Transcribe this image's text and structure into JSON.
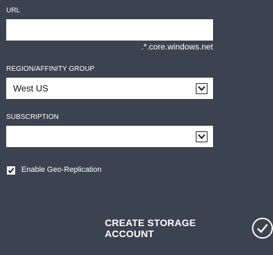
{
  "url": {
    "label": "URL",
    "value": "",
    "suffix": ".*.core.windows.net"
  },
  "region": {
    "label": "REGION/AFFINITY GROUP",
    "selected": "West US"
  },
  "subscription": {
    "label": "SUBSCRIPTION",
    "selected": ""
  },
  "geo_replication": {
    "label": "Enable Geo-Replication",
    "checked": true
  },
  "actions": {
    "create_label": "CREATE STORAGE ACCOUNT"
  },
  "colors": {
    "background": "#3c4350",
    "field": "#ffffff",
    "text": "#ffffff"
  },
  "icons": {
    "dropdown": "chevron-down-icon",
    "checkbox": "checkmark-icon",
    "create": "check-circle-icon"
  }
}
